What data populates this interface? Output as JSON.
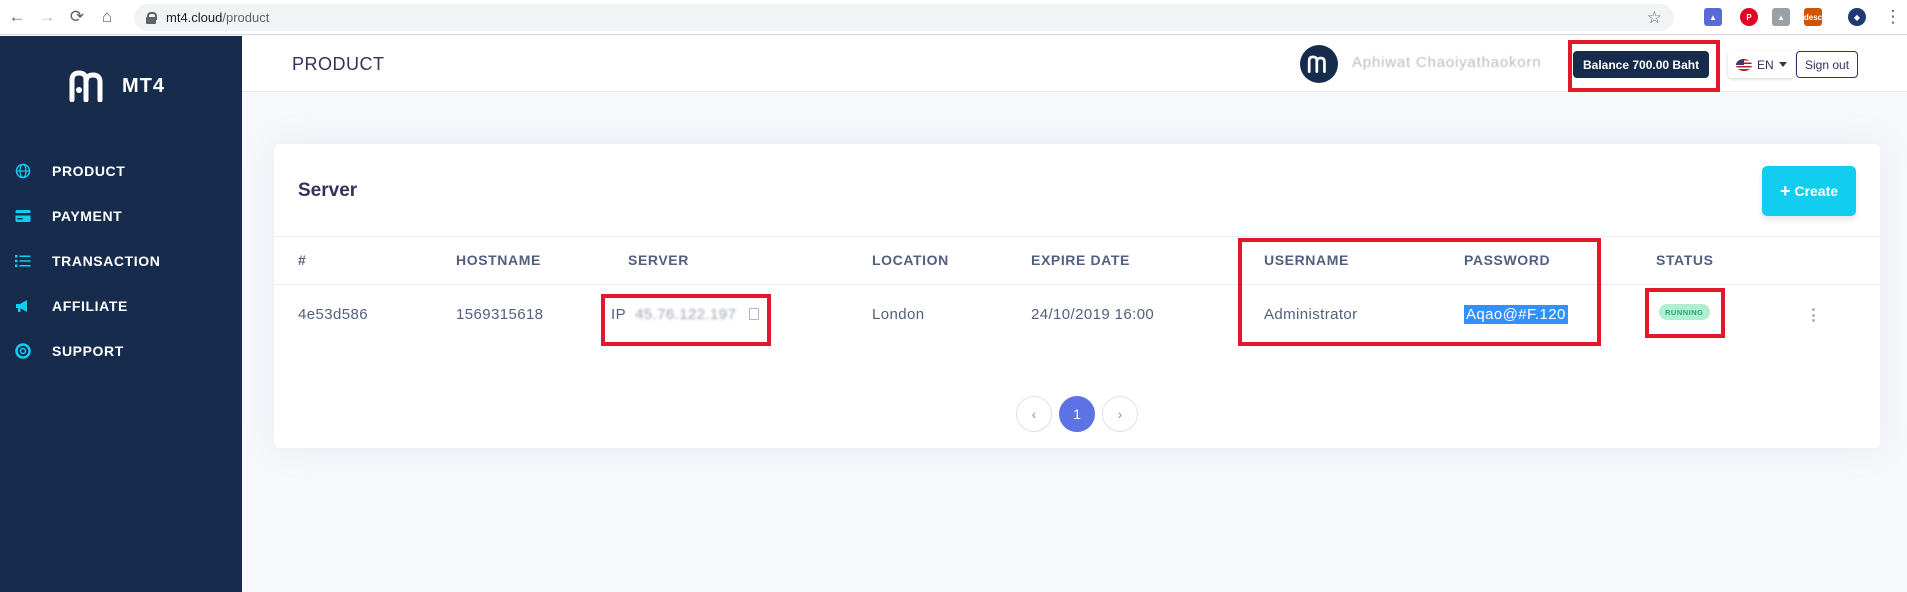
{
  "browser": {
    "url_host": "mt4.cloud",
    "url_path": "/product",
    "ext_desc_label": "desc"
  },
  "sidebar": {
    "logo_text": "MT4",
    "items": [
      {
        "label": "PRODUCT",
        "icon": "globe-icon"
      },
      {
        "label": "PAYMENT",
        "icon": "credit-card-icon"
      },
      {
        "label": "TRANSACTION",
        "icon": "list-icon"
      },
      {
        "label": "AFFILIATE",
        "icon": "megaphone-icon"
      },
      {
        "label": "SUPPORT",
        "icon": "lifebuoy-icon"
      }
    ]
  },
  "header": {
    "title": "PRODUCT",
    "user_name": "Aphiwat Chaoiyathaokorn",
    "balance": "Balance 700.00 Baht",
    "language": "EN",
    "signout": "Sign out"
  },
  "card": {
    "title": "Server",
    "create_label": "Create",
    "columns": [
      "#",
      "HOSTNAME",
      "SERVER",
      "LOCATION",
      "EXPIRE DATE",
      "USERNAME",
      "PASSWORD",
      "STATUS"
    ],
    "rows": [
      {
        "id": "4e53d586",
        "hostname": "1569315618",
        "server_prefix": "IP",
        "server_ip": "45.76.122.197",
        "location": "London",
        "expire_date": "24/10/2019 16:00",
        "username": "Administrator",
        "password": "Aqao@#F.120",
        "status": "RUNNING"
      }
    ],
    "pagination": {
      "prev": "‹",
      "current": "1",
      "next": "›"
    }
  },
  "colors": {
    "sidebar_bg": "#172b4d",
    "accent": "#11cdef",
    "primary": "#5e72e4",
    "annotation_red": "#e3192b",
    "status_green": "#1aae6f"
  }
}
